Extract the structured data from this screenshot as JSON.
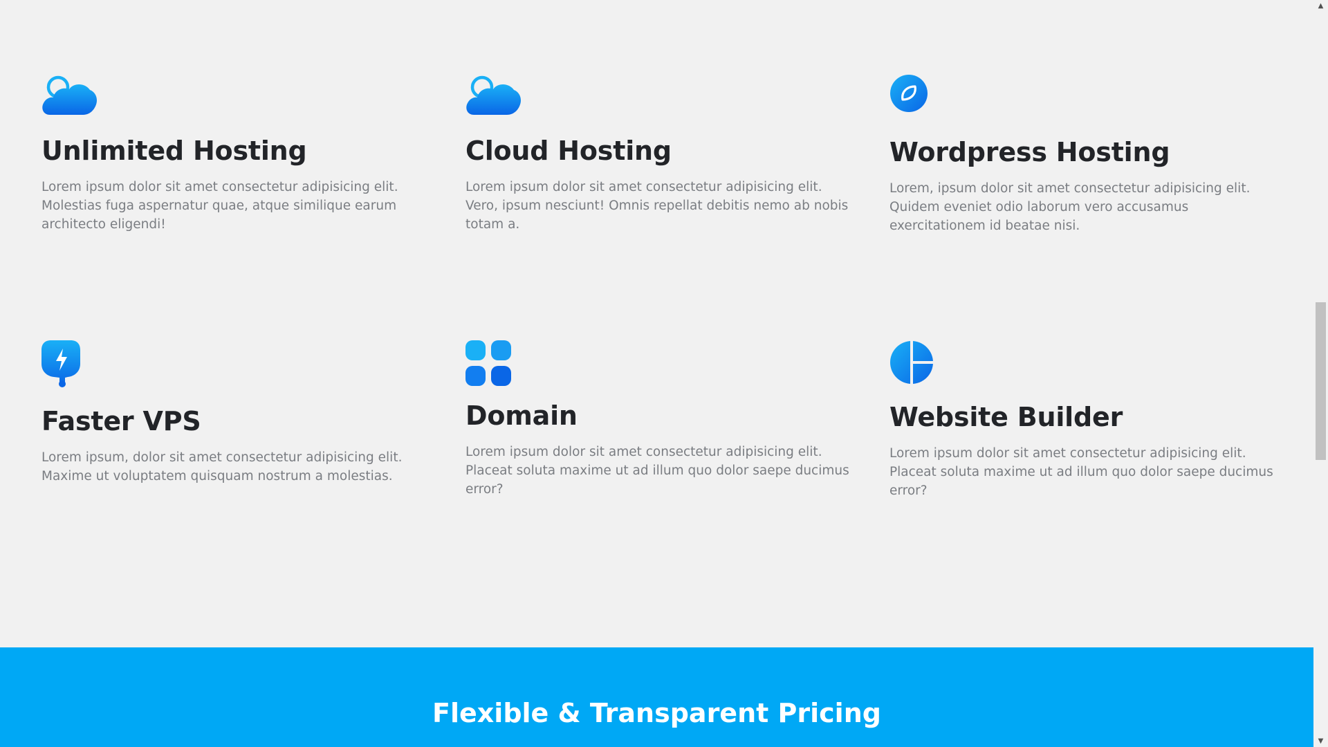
{
  "features": [
    {
      "title": "Unlimited Hosting",
      "description": "Lorem ipsum dolor sit amet consectetur adipisicing elit. Molestias fuga aspernatur quae, atque similique earum architecto eligendi!",
      "icon": "cloud-icon"
    },
    {
      "title": "Cloud Hosting",
      "description": "Lorem ipsum dolor sit amet consectetur adipisicing elit. Vero, ipsum nesciunt! Omnis repellat debitis nemo ab nobis totam a.",
      "icon": "cloud-icon"
    },
    {
      "title": "Wordpress Hosting",
      "description": "Lorem, ipsum dolor sit amet consectetur adipisicing elit. Quidem eveniet odio laborum vero accusamus exercitationem id beatae nisi.",
      "icon": "leaf-circle-icon"
    },
    {
      "title": "Faster VPS",
      "description": "Lorem ipsum, dolor sit amet consectetur adipisicing elit. Maxime ut voluptatem quisquam nostrum a molestias.",
      "icon": "lightning-pin-icon"
    },
    {
      "title": "Domain",
      "description": "Lorem ipsum dolor sit amet consectetur adipisicing elit. Placeat soluta maxime ut ad illum quo dolor saepe ducimus error?",
      "icon": "apps-grid-icon"
    },
    {
      "title": "Website Builder",
      "description": "Lorem ipsum dolor sit amet consectetur adipisicing elit. Placeat soluta maxime ut ad illum quo dolor saepe ducimus error?",
      "icon": "layout-circle-icon"
    }
  ],
  "pricing": {
    "title": "Flexible & Transparent Pricing"
  },
  "colors": {
    "page_background": "#f1f1f1",
    "heading": "#222428",
    "body_text": "#7a7d82",
    "accent": "#00a8f5",
    "icon_gradient_start": "#1ab0f6",
    "icon_gradient_end": "#0a66e6"
  },
  "scrollbar": {
    "up_arrow": "▲",
    "down_arrow": "▼"
  }
}
